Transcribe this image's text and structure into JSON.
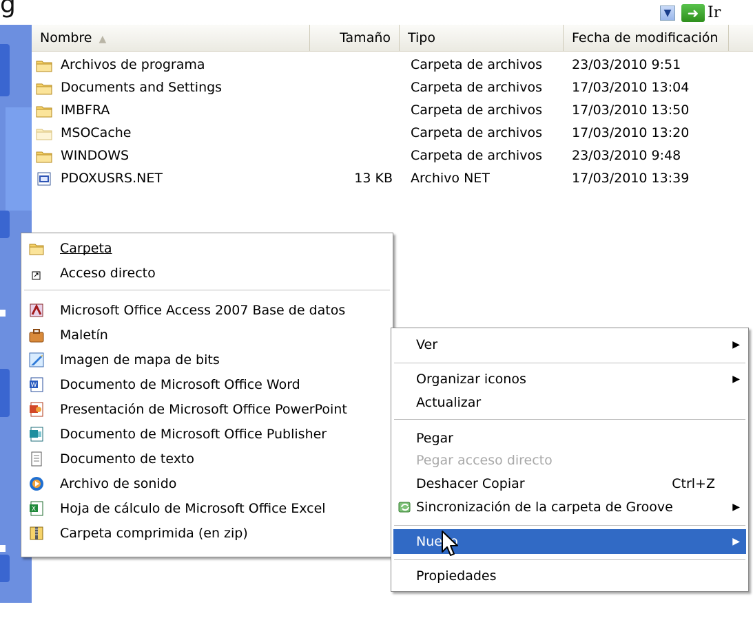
{
  "window": {
    "title_fragment": "g",
    "go_label": "Ir"
  },
  "columns": [
    "Nombre",
    "Tamaño",
    "Tipo",
    "Fecha de modificación"
  ],
  "files": [
    {
      "name": "Archivos de programa",
      "size": "",
      "type": "Carpeta de archivos",
      "modified": "23/03/2010 9:51",
      "icon": "folder-icon"
    },
    {
      "name": "Documents and Settings",
      "size": "",
      "type": "Carpeta de archivos",
      "modified": "17/03/2010 13:04",
      "icon": "folder-icon"
    },
    {
      "name": "IMBFRA",
      "size": "",
      "type": "Carpeta de archivos",
      "modified": "17/03/2010 13:50",
      "icon": "folder-icon"
    },
    {
      "name": "MSOCache",
      "size": "",
      "type": "Carpeta de archivos",
      "modified": "17/03/2010 13:20",
      "icon": "hidden-folder-icon"
    },
    {
      "name": "WINDOWS",
      "size": "",
      "type": "Carpeta de archivos",
      "modified": "23/03/2010 9:48",
      "icon": "folder-icon"
    },
    {
      "name": "PDOXUSRS.NET",
      "size": "13 KB",
      "type": "Archivo NET",
      "modified": "17/03/2010 13:39",
      "icon": "file-icon"
    }
  ],
  "context_menu": {
    "items": [
      {
        "label": "Ver",
        "submenu": true
      },
      {
        "label": "Organizar iconos",
        "submenu": true
      },
      {
        "label": "Actualizar"
      },
      {
        "label": "Pegar"
      },
      {
        "label": "Pegar acceso directo",
        "disabled": true
      },
      {
        "label": "Deshacer Copiar",
        "shortcut": "Ctrl+Z"
      },
      {
        "label": "Sincronización de la carpeta de Groove",
        "submenu": true,
        "icon": "groove-sync-icon"
      },
      {
        "label": "Nuevo",
        "submenu": true,
        "highlighted": true
      },
      {
        "label": "Propiedades"
      }
    ]
  },
  "new_submenu": {
    "items": [
      {
        "label": "Carpeta",
        "icon": "folder-icon"
      },
      {
        "label": "Acceso directo",
        "icon": "shortcut-icon"
      },
      {
        "label": "Microsoft Office Access 2007 Base de datos",
        "icon": "access-icon"
      },
      {
        "label": "Maletín",
        "icon": "briefcase-icon"
      },
      {
        "label": "Imagen de mapa de bits",
        "icon": "bitmap-icon"
      },
      {
        "label": "Documento de Microsoft Office Word",
        "icon": "word-icon"
      },
      {
        "label": "Presentación de Microsoft Office PowerPoint",
        "icon": "powerpoint-icon"
      },
      {
        "label": "Documento de Microsoft Office Publisher",
        "icon": "publisher-icon"
      },
      {
        "label": "Documento de texto",
        "icon": "text-document-icon"
      },
      {
        "label": "Archivo de sonido",
        "icon": "sound-file-icon"
      },
      {
        "label": "Hoja de cálculo de Microsoft Office Excel",
        "icon": "excel-icon"
      },
      {
        "label": "Carpeta comprimida (en zip)",
        "icon": "zip-folder-icon"
      }
    ]
  },
  "colors": {
    "highlight": "#316ac5",
    "disabled_text": "#a9a9a9",
    "folder": "#f6d36a"
  }
}
